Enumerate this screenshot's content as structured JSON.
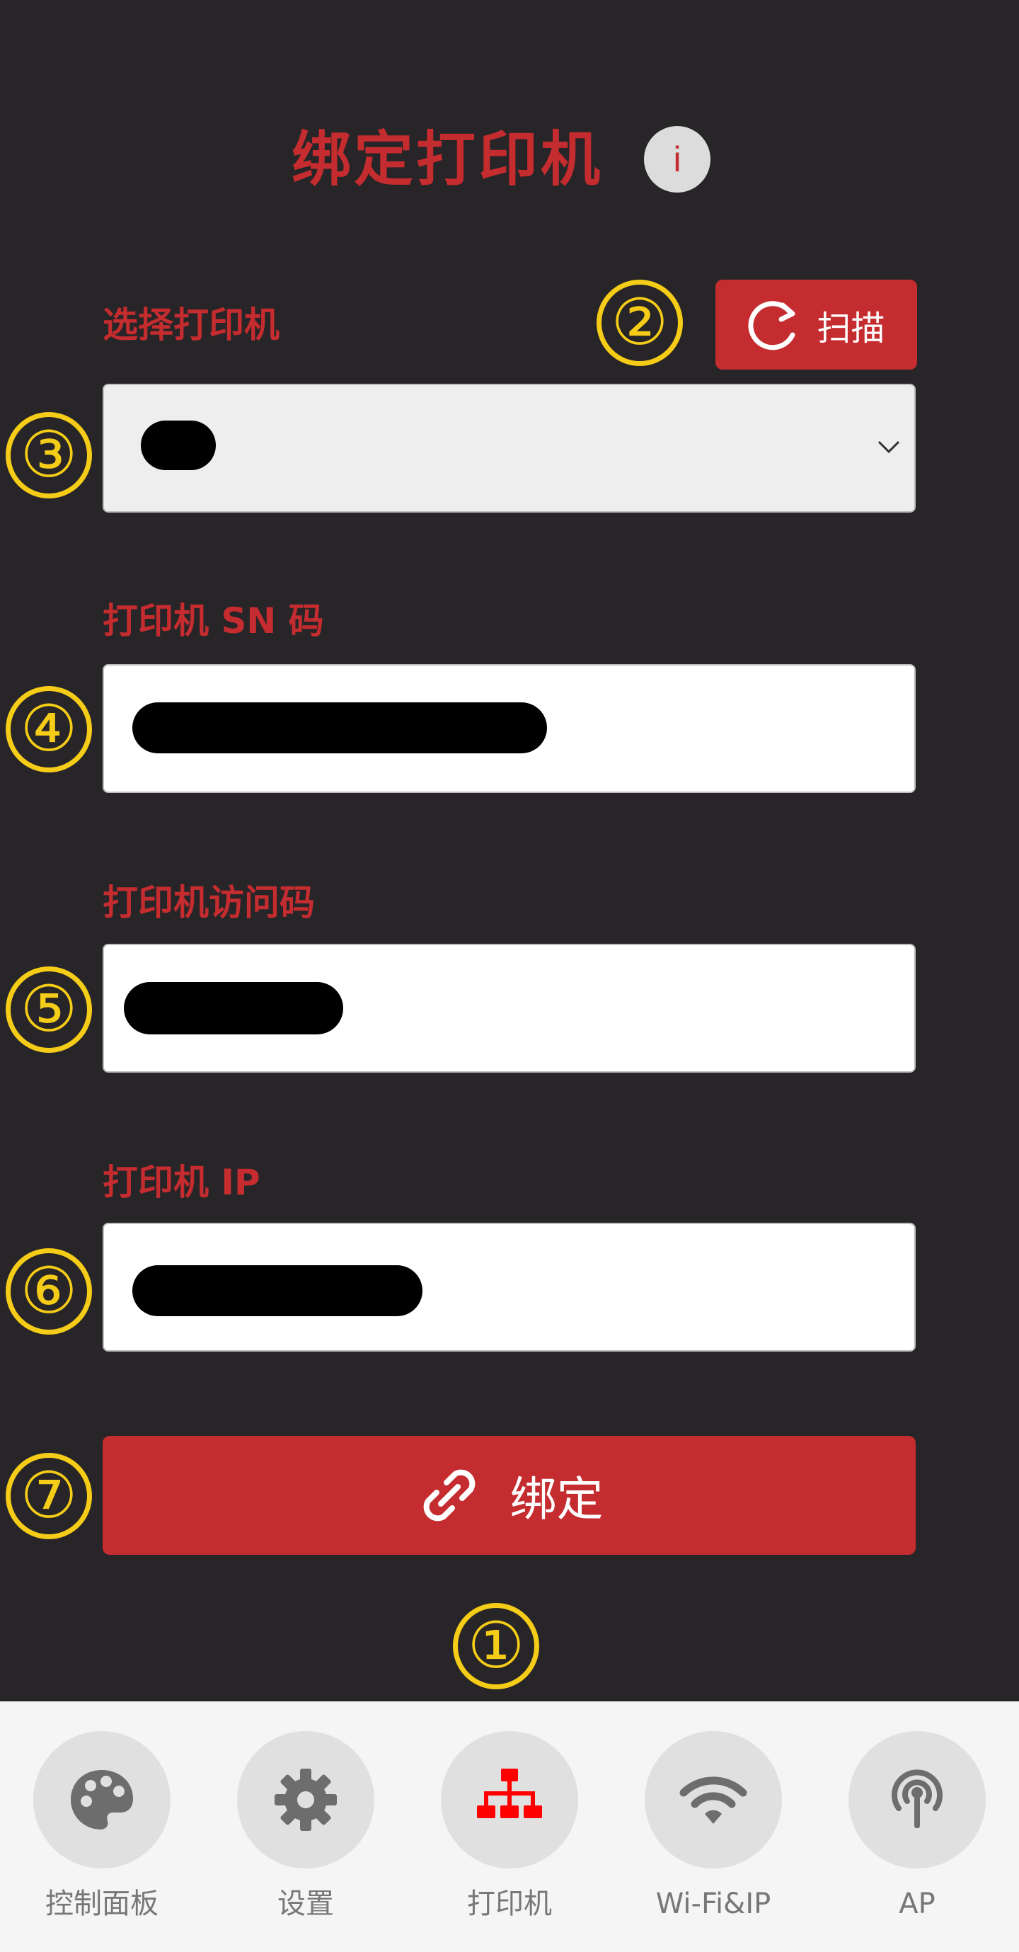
{
  "header": {
    "title": "绑定打印机",
    "info_glyph": "i",
    "info_icon": "info-icon"
  },
  "printer_select": {
    "label": "选择打印机",
    "scan_label": "扫描",
    "scan_icon": "refresh-icon",
    "selected_value": "",
    "dropdown_icon": "chevron-down-icon"
  },
  "sn": {
    "label": "打印机 SN 码",
    "value": ""
  },
  "access_code": {
    "label": "打印机访问码",
    "value": ""
  },
  "ip": {
    "label": "打印机 IP",
    "value": ""
  },
  "bind_button": {
    "label": "绑定",
    "icon": "link-icon"
  },
  "markers": [
    "①",
    "②",
    "③",
    "④",
    "⑤",
    "⑥",
    "⑦"
  ],
  "nav": {
    "items": [
      {
        "label": "控制面板",
        "icon": "palette-icon",
        "active": false
      },
      {
        "label": "设置",
        "icon": "gear-icon",
        "active": false
      },
      {
        "label": "打印机",
        "icon": "sitemap-icon",
        "active": true
      },
      {
        "label": "Wi-Fi&IP",
        "icon": "wifi-icon",
        "active": false
      },
      {
        "label": "AP",
        "icon": "antenna-icon",
        "active": false
      }
    ]
  },
  "colors": {
    "accent": "#c42c2f",
    "background": "#272527",
    "marker": "#f5cc17",
    "nav_active": "#ff0000"
  }
}
